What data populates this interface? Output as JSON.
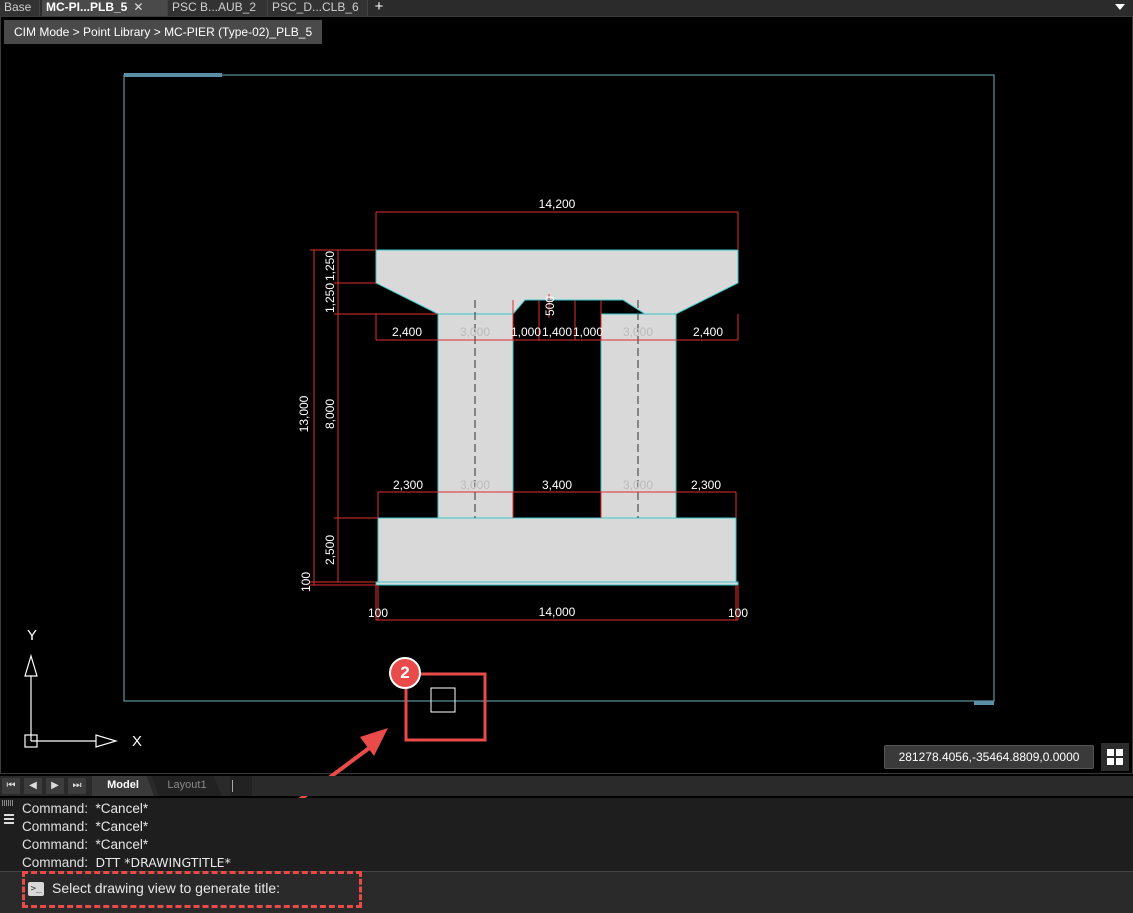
{
  "tabs": [
    {
      "label": "Base",
      "active": false
    },
    {
      "label": "MC-PI...PLB_5",
      "active": true
    },
    {
      "label": "PSC B...AUB_2",
      "active": false
    },
    {
      "label": "PSC_D...CLB_6",
      "active": false
    }
  ],
  "close_glyph": "✕",
  "add_tab_glyph": "+",
  "breadcrumb": "CIM Mode > Point Library > MC-PIER (Type-02)_PLB_5",
  "drawing": {
    "dims": {
      "top_width": "14,200",
      "cap_left_h": "1,250",
      "cap_left_h2": "1,250",
      "total_height": "13,000",
      "column_height": "8,000",
      "footing_height": "2,500",
      "base_offset": "100",
      "upper_row": [
        "2,400",
        "3,000",
        "1,000",
        "1,400",
        "1,000",
        "3,000",
        "2,400"
      ],
      "notch": "500",
      "lower_row": [
        "2,300",
        "3,000",
        "3,400",
        "3,000",
        "2,300"
      ],
      "bottom_left": "100",
      "bottom_width": "14,000",
      "bottom_right": "100"
    },
    "ucs": {
      "x_label": "X",
      "y_label": "Y"
    },
    "colors": {
      "concrete": "#d9d9d9",
      "dimension": "#e03030",
      "outline": "#39c6c6",
      "sheet": "#6fb0c4"
    }
  },
  "coords": "281278.4056,-35464.8809,0.0000",
  "layout_tabs": {
    "model": "Model",
    "layout1": "Layout1"
  },
  "nav_glyphs": [
    "⏮",
    "◀",
    "▶",
    "⏭"
  ],
  "command_history": [
    {
      "prefix": "Command:",
      "text": "*Cancel*"
    },
    {
      "prefix": "Command:",
      "text": "*Cancel*"
    },
    {
      "prefix": "Command:",
      "text": "*Cancel*"
    },
    {
      "prefix": "Command:",
      "text": "DTT *DRAWINGTITLE*"
    }
  ],
  "prompt": {
    "icon": ">_",
    "text": "Select drawing view to generate title:"
  },
  "annotation": {
    "step": "2",
    "color": "#e94b4b"
  }
}
